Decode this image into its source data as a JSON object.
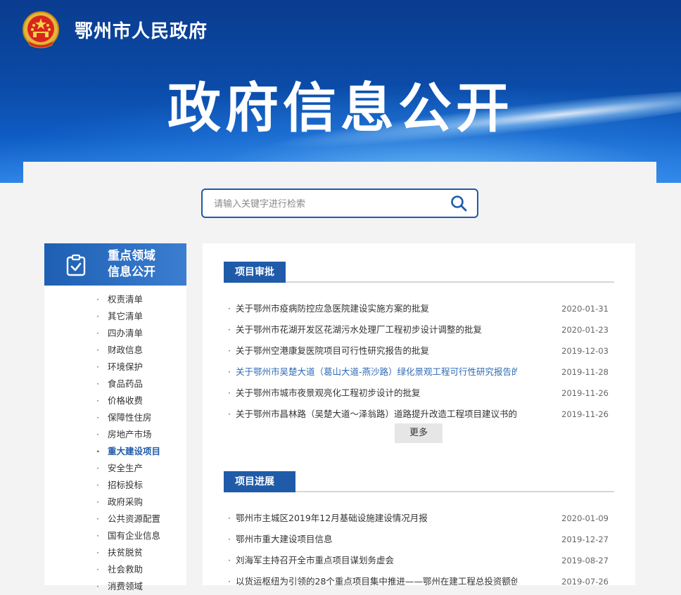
{
  "header": {
    "site_name": "鄂州市人民政府",
    "page_title": "政府信息公开"
  },
  "search": {
    "placeholder": "请输入关键字进行检索",
    "icon": "search-icon"
  },
  "sidebar": {
    "title_line1": "重点领域",
    "title_line2": "信息公开",
    "items": [
      {
        "label": "权责清单"
      },
      {
        "label": "其它清单"
      },
      {
        "label": "四办清单"
      },
      {
        "label": "财政信息"
      },
      {
        "label": "环境保护"
      },
      {
        "label": "食品药品"
      },
      {
        "label": "价格收费"
      },
      {
        "label": "保障性住房"
      },
      {
        "label": "房地产市场"
      },
      {
        "label": "重大建设项目",
        "active": true
      },
      {
        "label": "安全生产"
      },
      {
        "label": "招标投标"
      },
      {
        "label": "政府采购"
      },
      {
        "label": "公共资源配置"
      },
      {
        "label": "国有企业信息"
      },
      {
        "label": "扶贫脱贫"
      },
      {
        "label": "社会救助"
      },
      {
        "label": "消费领域"
      }
    ]
  },
  "sections": [
    {
      "title": "项目审批",
      "more_label": "更多",
      "items": [
        {
          "title": "关于鄂州市疫病防控应急医院建设实施方案的批复",
          "date": "2020-01-31"
        },
        {
          "title": "关于鄂州市花湖开发区花湖污水处理厂工程初步设计调整的批复",
          "date": "2020-01-23"
        },
        {
          "title": "关于鄂州空港康复医院项目可行性研究报告的批复",
          "date": "2019-12-03"
        },
        {
          "title": "关于鄂州市吴楚大道（葛山大道-燕沙路）绿化景观工程可行性研究报告的...",
          "date": "2019-11-28",
          "highlight": true
        },
        {
          "title": "关于鄂州市城市夜景观亮化工程初步设计的批复",
          "date": "2019-11-26"
        },
        {
          "title": "关于鄂州市昌林路（吴楚大道～泽翁路）道路提升改造工程项目建议书的...",
          "date": "2019-11-26"
        }
      ]
    },
    {
      "title": "项目进展",
      "items": [
        {
          "title": "鄂州市主城区2019年12月基础设施建设情况月报",
          "date": "2020-01-09"
        },
        {
          "title": "鄂州市重大建设项目信息",
          "date": "2019-12-27"
        },
        {
          "title": "刘海军主持召开全市重点项目谋划务虚会",
          "date": "2019-08-27"
        },
        {
          "title": "以货运枢纽为引领的28个重点项目集中推进——鄂州在建工程总投资额创",
          "date": "2019-07-26"
        }
      ]
    }
  ]
}
